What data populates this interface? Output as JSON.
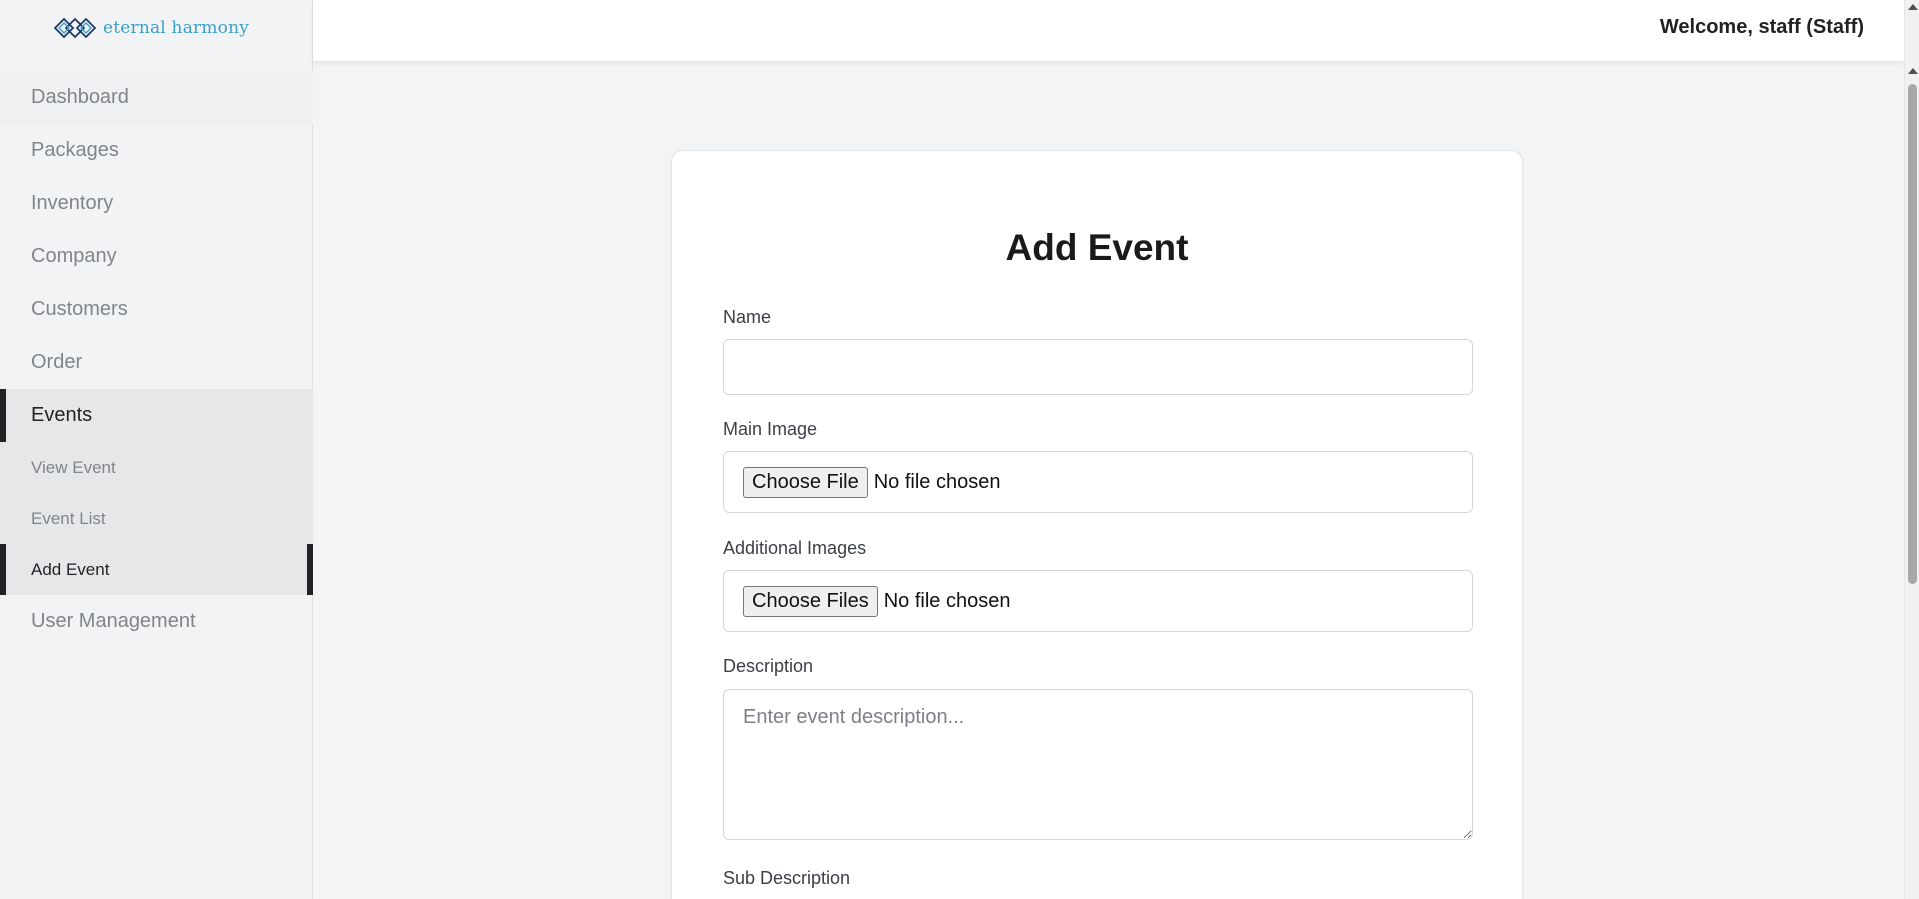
{
  "app": {
    "logo_text": "eternal harmony"
  },
  "header": {
    "welcome": "Welcome, staff (Staff)"
  },
  "sidebar": {
    "items": [
      {
        "label": "Dashboard"
      },
      {
        "label": "Packages"
      },
      {
        "label": "Inventory"
      },
      {
        "label": "Company"
      },
      {
        "label": "Customers"
      },
      {
        "label": "Order"
      },
      {
        "label": "Events"
      },
      {
        "label": "User Management"
      }
    ],
    "events_sub": [
      {
        "label": "View Event"
      },
      {
        "label": "Event List"
      },
      {
        "label": "Add Event"
      }
    ]
  },
  "form": {
    "title": "Add Event",
    "name_label": "Name",
    "name_value": "",
    "main_image_label": "Main Image",
    "main_image_button": "Choose File",
    "main_image_status": "No file chosen",
    "additional_images_label": "Additional Images",
    "additional_images_button": "Choose Files",
    "additional_images_status": "No file chosen",
    "description_label": "Description",
    "description_placeholder": "Enter event description...",
    "sub_description_label": "Sub Description"
  },
  "colors": {
    "accent": "#3a9fc9",
    "active_bar": "#202226",
    "background": "#f3f4f5"
  }
}
